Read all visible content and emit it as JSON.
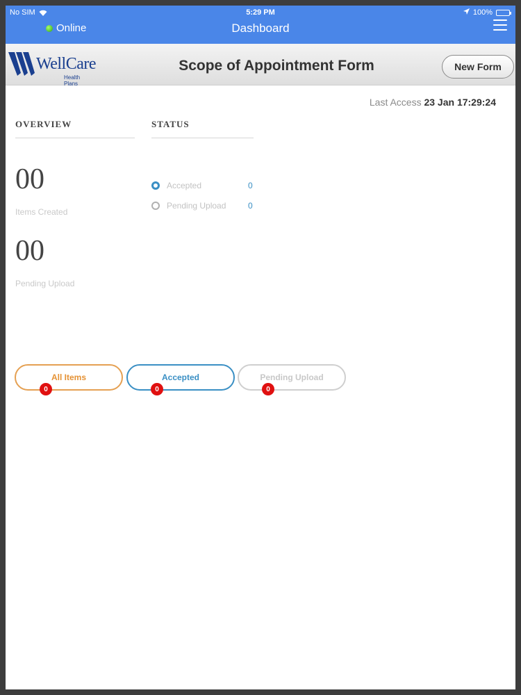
{
  "status_bar": {
    "carrier": "No SIM",
    "time": "5:29 PM",
    "battery": "100%"
  },
  "nav": {
    "online_label": "Online",
    "title": "Dashboard"
  },
  "header": {
    "logo_text": "WellCare",
    "logo_sub": "Health Plans",
    "title": "Scope of Appointment Form",
    "new_form_label": "New Form"
  },
  "last_access": {
    "label": "Last Access",
    "value": "23 Jan 17:29:24"
  },
  "overview": {
    "heading": "OVERVIEW",
    "items_created": {
      "value": "00",
      "label": "Items Created"
    },
    "pending_upload": {
      "value": "00",
      "label": "Pending Upload"
    }
  },
  "status": {
    "heading": "STATUS",
    "rows": [
      {
        "label": "Accepted",
        "value": "0"
      },
      {
        "label": "Pending Upload",
        "value": "0"
      }
    ]
  },
  "filters": [
    {
      "label": "All Items",
      "count": "0"
    },
    {
      "label": "Accepted",
      "count": "0"
    },
    {
      "label": "Pending Upload",
      "count": "0"
    }
  ],
  "colors": {
    "nav_blue": "#4a86e8",
    "accent_orange": "#e59235",
    "accent_blue": "#3a8fc4",
    "badge_red": "#e01010"
  }
}
